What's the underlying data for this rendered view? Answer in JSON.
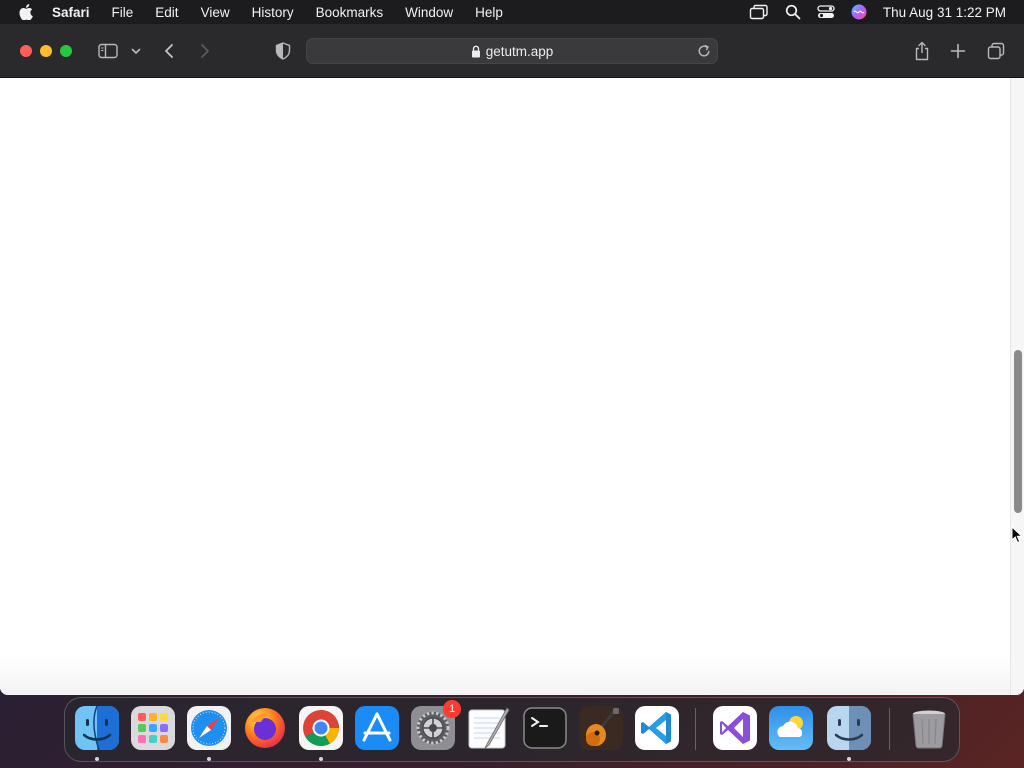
{
  "menubar": {
    "app_name": "Safari",
    "items": [
      "File",
      "Edit",
      "View",
      "History",
      "Bookmarks",
      "Window",
      "Help"
    ],
    "clock": "Thu Aug 31  1:22 PM"
  },
  "safari": {
    "address": "getutm.app",
    "scroll_position": 0.6
  },
  "dock": {
    "apps": [
      {
        "name": "Finder",
        "running": true
      },
      {
        "name": "Launchpad",
        "running": false
      },
      {
        "name": "Safari",
        "running": true
      },
      {
        "name": "Firefox",
        "running": false
      },
      {
        "name": "Google Chrome",
        "running": true
      },
      {
        "name": "App Store",
        "running": false
      },
      {
        "name": "System Settings",
        "running": false,
        "badge": "1"
      },
      {
        "name": "TextEdit",
        "running": false
      },
      {
        "name": "Terminal",
        "running": false
      },
      {
        "name": "GarageBand",
        "running": false
      },
      {
        "name": "Visual Studio Code",
        "running": false
      },
      {
        "name": "Visual Studio",
        "running": false
      },
      {
        "name": "Weather",
        "running": false
      },
      {
        "name": "Finder",
        "running": true
      },
      {
        "name": "Trash",
        "running": false
      }
    ]
  }
}
